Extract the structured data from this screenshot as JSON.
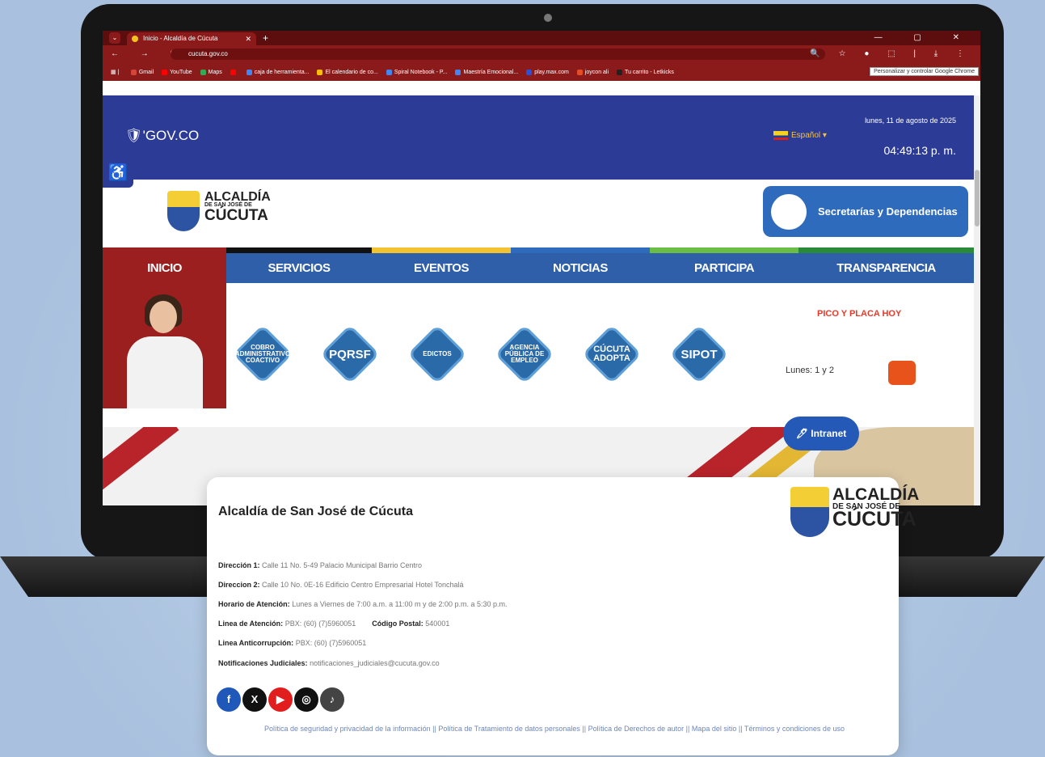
{
  "browser": {
    "tab_title": "Inicio - Alcaldía de Cúcuta",
    "tab_close": "✕",
    "new_tab": "+",
    "window_controls": "—  ▢  ✕",
    "nav_buttons": "←  →  C",
    "url": "cucuta.gov.co",
    "address_icons": "🔍 ☆ ● ⬚ | ⤓ ⋮",
    "tooltip": "Personalizar y controlar Google Chrome",
    "bookmarks": [
      {
        "label": "Gmail",
        "color": "#d44638"
      },
      {
        "label": "YouTube",
        "color": "#ff0000"
      },
      {
        "label": "Maps",
        "color": "#34a853"
      },
      {
        "label": "",
        "color": "#ff0000"
      },
      {
        "label": "caja de herramienta...",
        "color": "#4285f4"
      },
      {
        "label": "El calendario de co...",
        "color": "#fbbc05"
      },
      {
        "label": "Spiral Notebook - P...",
        "color": "#4285f4"
      },
      {
        "label": "Maestría Emocional...",
        "color": "#4285f4"
      },
      {
        "label": "play.max.com",
        "color": "#2a4fd8"
      },
      {
        "label": "joycon ali",
        "color": "#e44d26"
      },
      {
        "label": "Tu carrito - Letkicks",
        "color": "#222222"
      }
    ]
  },
  "header": {
    "govco": "🛡'GOV.CO",
    "language": "Español ▾",
    "date": "lunes, 11 de agosto de 2025",
    "time": "04:49:13 p. m.",
    "accessibility_icon": "♿"
  },
  "logo": {
    "line1": "ALCALDÍA",
    "line2": "DE SAN JOSÉ DE",
    "line3": "CÚCUTA"
  },
  "secretarias_button": "Secretarías y Dependencias",
  "menu": [
    "INICIO",
    "SERVICIOS",
    "EVENTOS",
    "NOTICIAS",
    "PARTICIPA",
    "TRANSPARENCIA"
  ],
  "services": [
    {
      "label": "COBRO ADMINISTRATIVO COACTIVO",
      "size": "small"
    },
    {
      "label": "PQRSF",
      "size": "big"
    },
    {
      "label": "EDICTOS",
      "size": "small"
    },
    {
      "label": "AGENCIA PÚBLICA DE EMPLEO",
      "size": "small"
    },
    {
      "label": "CÚCUTA ADOPTA",
      "size": "mid"
    },
    {
      "label": "SIPOT",
      "size": "big"
    }
  ],
  "pico_placa": {
    "title": "PICO Y PLACA HOY",
    "value": "Lunes: 1 y 2"
  },
  "intranet": "🖊 Intranet",
  "footer": {
    "title": "Alcaldía de San José de Cúcuta",
    "rows": [
      {
        "label": "Dirección 1:",
        "value": "Calle 11 No. 5-49 Palacio Municipal Barrio Centro"
      },
      {
        "label": "Direccion 2:",
        "value": "Calle 10 No. 0E-16 Edificio Centro Empresarial Hotel Tonchalá"
      },
      {
        "label": "Horario de Atención:",
        "value": "Lunes a Viernes de 7:00 a.m. a 11:00 m y de 2:00 p.m. a 5:30 p.m."
      },
      {
        "label": "Linea de Atención:",
        "value": "PBX: (60) (7)5960051"
      },
      {
        "label": "Linea Anticorrupción:",
        "value": "PBX: (60) (7)5960051"
      },
      {
        "label": "Notificaciones Judiciales:",
        "value": "notificaciones_judiciales@cucuta.gov.co"
      }
    ],
    "postal_label": "Código Postal:",
    "postal_value": "540001",
    "social": [
      {
        "icon": "f",
        "name": "facebook-icon",
        "color": "#1f58b8"
      },
      {
        "icon": "X",
        "name": "x-icon",
        "color": "#111111"
      },
      {
        "icon": "▶",
        "name": "youtube-icon",
        "color": "#e11d1d"
      },
      {
        "icon": "◎",
        "name": "instagram-icon",
        "color": "#111111"
      },
      {
        "icon": "♪",
        "name": "tiktok-icon",
        "color": "#444444"
      }
    ],
    "links": "Política de seguridad y privacidad de la información || Política de Tratamiento de datos personales || Política de Derechos de autor || Mapa del sitio || Términos y condiciones de uso"
  }
}
